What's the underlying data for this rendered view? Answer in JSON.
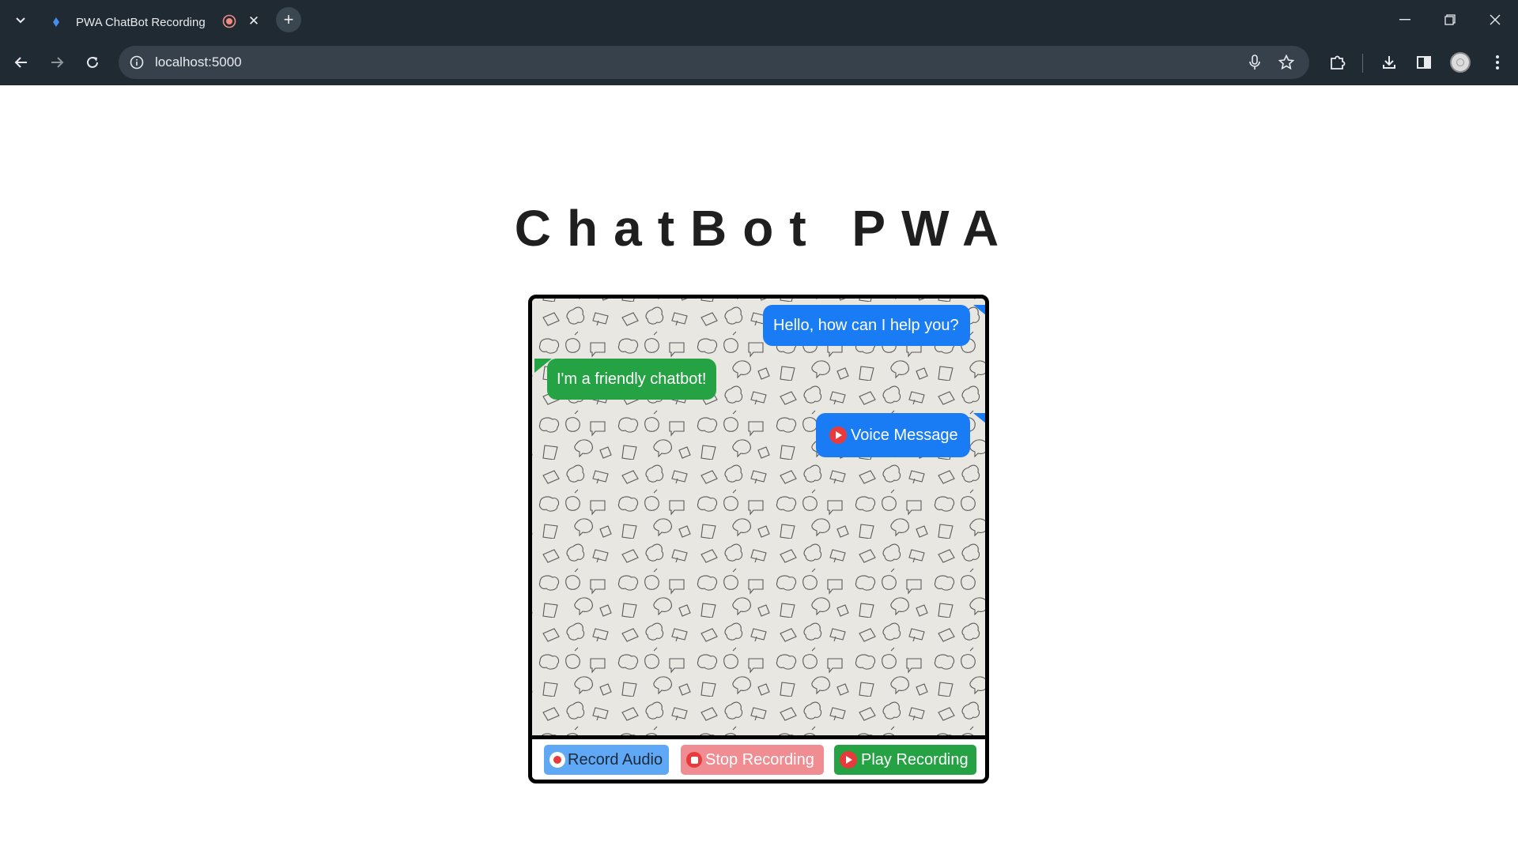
{
  "browser": {
    "tab_title": "PWA ChatBot Recording",
    "url": "localhost:5000",
    "icons": [
      "tab-search-icon",
      "favicon-icon",
      "recording-indicator-icon",
      "close-icon",
      "plus-icon",
      "minimize-icon",
      "restore-icon",
      "window-close-icon",
      "back-arrow-icon",
      "forward-arrow-icon",
      "reload-icon",
      "info-icon",
      "microphone-icon",
      "star-icon",
      "extensions-icon",
      "download-icon",
      "side-panel-icon",
      "profile-avatar",
      "more-vert-icon"
    ]
  },
  "page": {
    "title": "ChatBot PWA"
  },
  "chat": {
    "messages": [
      {
        "sender": "user",
        "text": "Hello, how can I help you?",
        "color": "#1a7cf5"
      },
      {
        "sender": "bot",
        "text": "I'm a friendly chatbot!",
        "color": "#25a244"
      },
      {
        "sender": "user",
        "type": "voice",
        "text": "Voice Message",
        "color": "#1a7cf5"
      }
    ],
    "background_color": "#e8e7e1"
  },
  "controls": {
    "record_label": "Record Audio",
    "stop_label": "Stop Recording",
    "play_label": "Play Recording",
    "record_color": "#5fa8f5",
    "stop_color": "#f08d92",
    "play_color": "#25a244"
  }
}
